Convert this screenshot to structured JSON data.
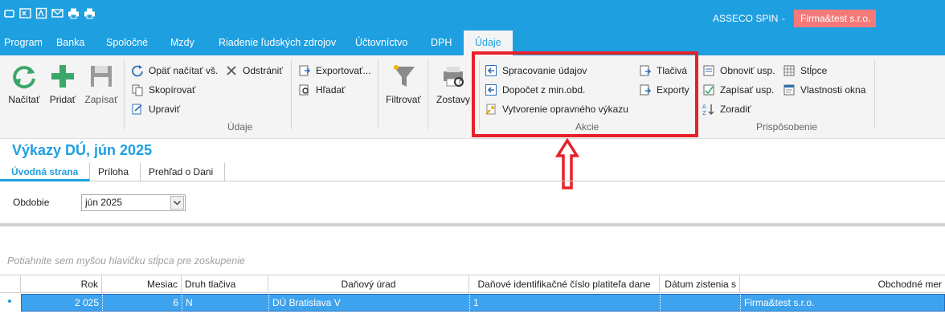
{
  "titlebar": {
    "app_name": "ASSECO SPIN",
    "dash": "-",
    "company": "Firma&test s.r.o."
  },
  "menu": [
    {
      "label": "Program"
    },
    {
      "label": "Banka"
    },
    {
      "label": "Spoločné"
    },
    {
      "label": "Mzdy"
    },
    {
      "label": "Riadenie ľudských zdrojov"
    },
    {
      "label": "Účtovníctvo"
    },
    {
      "label": "DPH"
    },
    {
      "label": "Údaje"
    }
  ],
  "ribbon": {
    "nacitat": "Načítať",
    "pridat": "Pridať",
    "zapisat": "Zapísať",
    "opat_nacitat": "Opäť načítať vš.",
    "odstranit": "Odstrániť",
    "skopirovat": "Skopírovať",
    "upravit": "Upraviť",
    "exportovat": "Exportovať...",
    "hladat": "Hľadať",
    "filtrovat": "Filtrovať",
    "zostavy": "Zostavy",
    "group_udaje": "Údaje",
    "spracovanie": "Spracovanie údajov",
    "dopocet": "Dopočet z min.obd.",
    "vytvorenie": "Vytvorenie opravného výkazu",
    "tlaciva": "Tlačivá",
    "exporty": "Exporty",
    "group_akcie": "Akcie",
    "obnovit": "Obnoviť usp.",
    "zapisat_usp": "Zapísať usp.",
    "zoradit": "Zoradiť",
    "stlpce": "Stĺpce",
    "vlastnosti": "Vlastnosti okna",
    "group_prisp": "Prispôsobenie"
  },
  "page": {
    "title": "Výkazy DÚ, jún 2025"
  },
  "tabs": [
    {
      "label": "Úvodná strana"
    },
    {
      "label": "Príloha"
    },
    {
      "label": "Prehľad o Dani"
    }
  ],
  "filter": {
    "label": "Obdobie",
    "value": "jún 2025"
  },
  "grid": {
    "hint": "Potiahnite sem myšou hlavičku stĺpca pre zoskupenie",
    "columns": [
      "Rok",
      "Mesiac",
      "Druh tlačiva",
      "Daňový úrad",
      "Daňové identifikačné číslo platiteľa dane",
      "Dátum zistenia s",
      "Obchodné mer"
    ],
    "rows": [
      [
        "2 025",
        "6",
        "N",
        "DÚ Bratislava V",
        "1",
        "",
        "Firma&test s.r.o."
      ]
    ]
  },
  "colors": {
    "accent": "#1e9fe0",
    "highlight": "#e8202a",
    "company_bg": "#f47a7a",
    "row_selected": "#3ea3ee"
  }
}
